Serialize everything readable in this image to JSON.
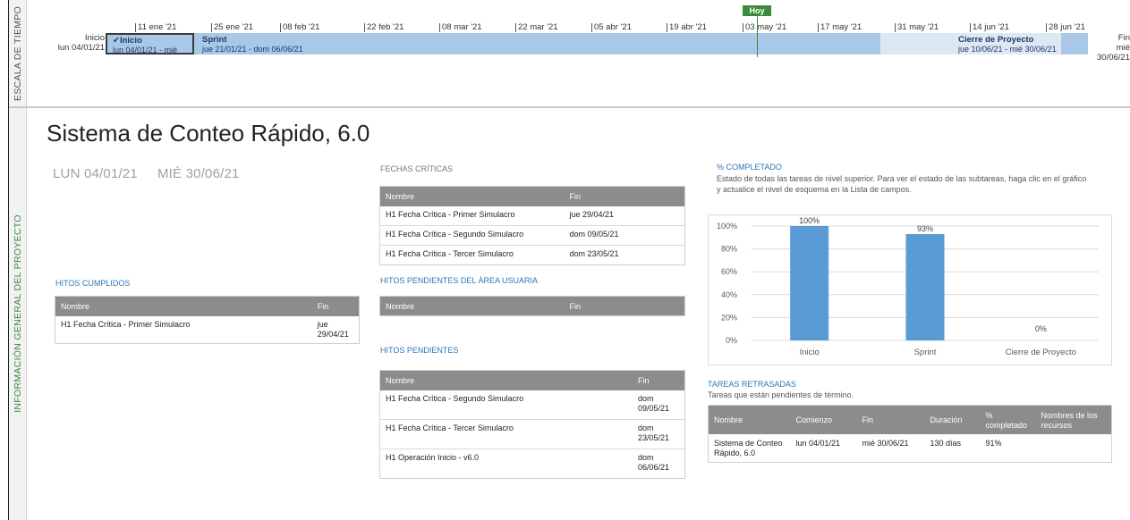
{
  "timeline": {
    "side_label": "ESCALA DE TIEMPO",
    "start_label": "Inicio",
    "start_date": "lun 04/01/21",
    "end_label": "Fin",
    "end_date": "mié 30/06/21",
    "today_label": "Hoy",
    "ticks": [
      "11 ene '21",
      "25 ene '21",
      "08 feb '21",
      "22 feb '21",
      "08 mar '21",
      "22 mar '21",
      "05 abr '21",
      "19 abr '21",
      "03 may '21",
      "17 may '21",
      "31 may '21",
      "14 jun '21",
      "28 jun '21"
    ],
    "bars": {
      "inicio": {
        "check": "✔",
        "title": "Inicio",
        "dates": "lun 04/01/21 - mié"
      },
      "sprint": {
        "title": "Sprint",
        "dates": "jue 21/01/21 - dom 06/06/21"
      },
      "cierre": {
        "title": "Cierre de Proyecto",
        "dates": "jue 10/06/21 - mié 30/06/21"
      }
    }
  },
  "overview": {
    "side_label": "INFORMACIÓN GENERAL DEL PROYECTO",
    "title": "Sistema de Conteo Rápido, 6.0",
    "start": "LUN 04/01/21",
    "finish": "MIÉ 30/06/21"
  },
  "fechas_criticas": {
    "title": "FECHAS CRÍTICAS",
    "headers": [
      "Nombre",
      "Fin"
    ],
    "rows": [
      [
        "H1 Fecha Crítica - Primer Simulacro",
        "jue 29/04/21"
      ],
      [
        "H1 Fecha Crítica - Segundo Simulacro",
        "dom 09/05/21"
      ],
      [
        "H1 Fecha Crítica - Tercer Simulacro",
        "dom 23/05/21"
      ]
    ]
  },
  "hitos_cumplidos": {
    "title": "HITOS CUMPLIDOS",
    "headers": [
      "Nombre",
      "Fin"
    ],
    "rows": [
      [
        "H1 Fecha Crítica - Primer Simulacro",
        "jue 29/04/21"
      ]
    ]
  },
  "hitos_area_usuaria": {
    "title": "HITOS PENDIENTES DEL ÁREA USUARIA",
    "headers": [
      "Nombre",
      "Fin"
    ]
  },
  "hitos_pendientes": {
    "title": "HITOS PENDIENTES",
    "headers": [
      "Nombre",
      "Fin"
    ],
    "rows": [
      [
        "H1 Fecha Crítica - Segundo Simulacro",
        "dom 09/05/21"
      ],
      [
        "H1 Fecha Crítica - Tercer Simulacro",
        "dom 23/05/21"
      ],
      [
        "H1 Operación Inicio - v6.0",
        "dom 06/06/21"
      ]
    ]
  },
  "porcentaje": {
    "title": "% COMPLETADO",
    "description": "Estado de todas las tareas de nivel superior. Para ver el estado de las subtareas, haga clic en el gráfico y actualice el nivel de esquema en la Lista de campos."
  },
  "chart_data": {
    "type": "bar",
    "categories": [
      "Inicio",
      "Sprint",
      "Cierre de Proyecto"
    ],
    "values": [
      100,
      93,
      0
    ],
    "data_labels": [
      "100%",
      "93%",
      "0%"
    ],
    "y_ticks": [
      "0%",
      "20%",
      "40%",
      "60%",
      "80%",
      "100%"
    ],
    "ylim": [
      0,
      100
    ],
    "grid": true,
    "bar_color": "#5b9bd5"
  },
  "tareas_retrasadas": {
    "title": "TAREAS RETRASADAS",
    "subtitle": "Tareas que están pendientes de término.",
    "headers": [
      "Nombre",
      "Comienzo",
      "Fin",
      "Duración",
      "% completado",
      "Nombres de los recursos"
    ],
    "rows": [
      [
        "Sistema de Conteo Rápido, 6.0",
        "lun 04/01/21",
        "mié 30/06/21",
        "130 días",
        "91%",
        ""
      ]
    ]
  },
  "colors": {
    "accent_blue": "#2e75b6",
    "today_green": "#3c8a3c",
    "header_grey": "#8c8c8c"
  }
}
